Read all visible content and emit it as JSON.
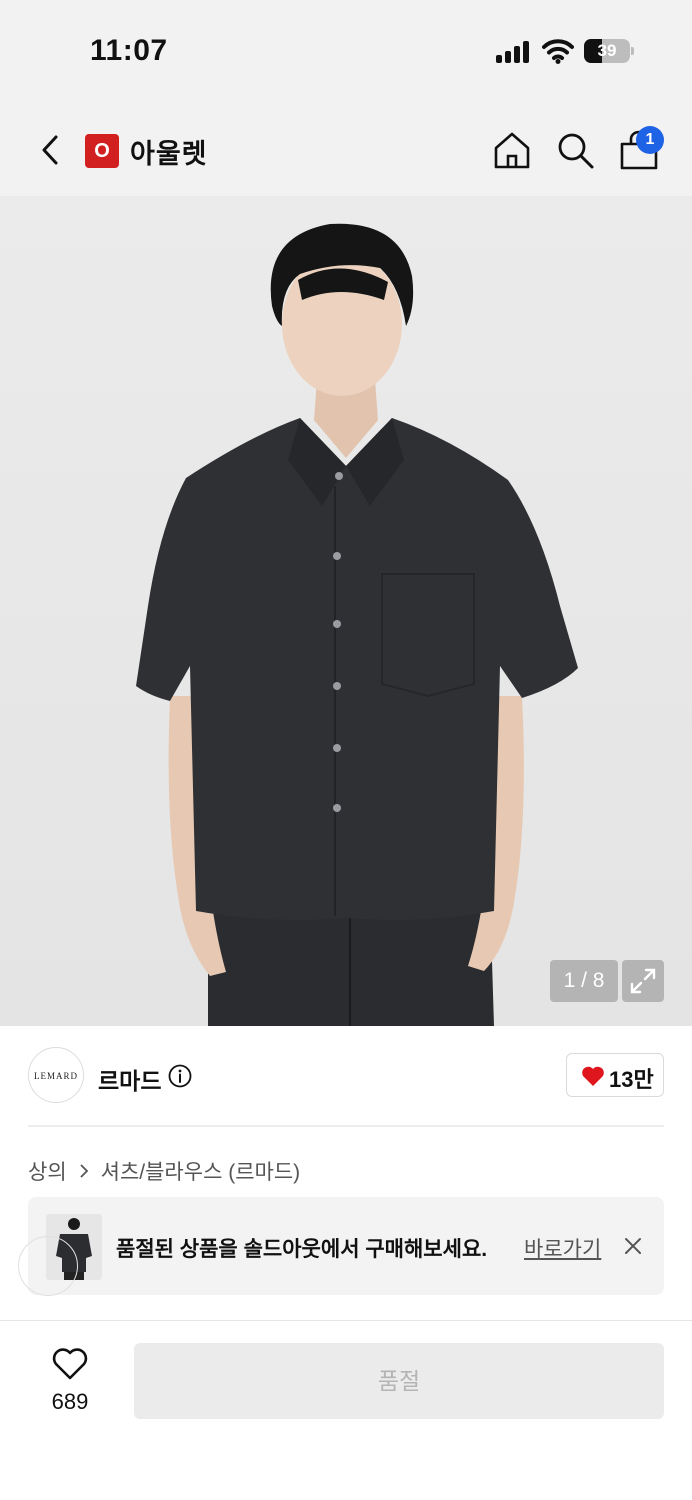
{
  "status_bar": {
    "time": "11:07",
    "battery": "39",
    "battery_level": 0.39
  },
  "header": {
    "logo_letter": "O",
    "title": "아울렛",
    "cart_count": "1",
    "icons": [
      "back-icon",
      "home-icon",
      "search-icon",
      "shopping-bag-icon"
    ],
    "logo_color": "#d21f1f",
    "badge_color": "#1e62e6"
  },
  "gallery": {
    "counter": "1 / 8",
    "expand_icon": "expand-icon"
  },
  "brand": {
    "logo_text": "LEMARD",
    "name": "르마드",
    "likes": "13만",
    "heart_color": "#e0161e"
  },
  "breadcrumb": {
    "items": [
      "상의",
      "셔츠/블라우스 (르마드)"
    ]
  },
  "soldout_banner": {
    "text": "품절된 상품을 솔드아웃에서 구매해보세요.",
    "link": "바로가기"
  },
  "bottom_bar": {
    "wish_count": "689",
    "buy_label": "품절"
  }
}
